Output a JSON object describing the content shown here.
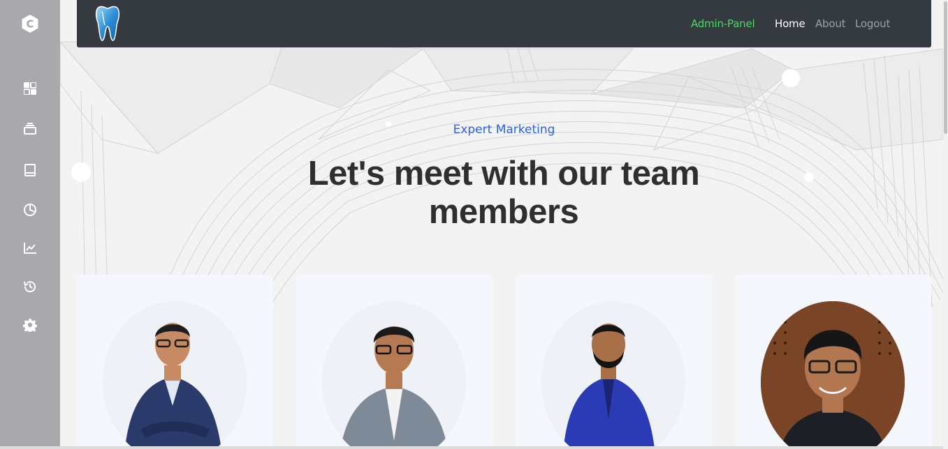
{
  "nav": {
    "admin_label": "Admin-Panel",
    "home_label": "Home",
    "about_label": "About",
    "logout_label": "Logout"
  },
  "sidebar": {
    "items": [
      {
        "icon": "dashboard-icon"
      },
      {
        "icon": "layers-icon"
      },
      {
        "icon": "book-icon"
      },
      {
        "icon": "pie-chart-icon"
      },
      {
        "icon": "line-chart-icon"
      },
      {
        "icon": "history-icon"
      },
      {
        "icon": "settings-icon"
      }
    ]
  },
  "hero": {
    "subtitle": "Expert Marketing",
    "headline": "Let's meet with our team members"
  },
  "team": {
    "members": [
      {
        "photo": "team-member-photo-1"
      },
      {
        "photo": "team-member-photo-2"
      },
      {
        "photo": "team-member-photo-3"
      },
      {
        "photo": "team-member-photo-4"
      }
    ]
  },
  "colors": {
    "sidebar": "#a9a9ad",
    "navbar": "#343a40",
    "admin_link": "#4cd964",
    "subtitle": "#2b63e4",
    "headline": "#2f2f2f",
    "card": "#f4f7fc"
  }
}
